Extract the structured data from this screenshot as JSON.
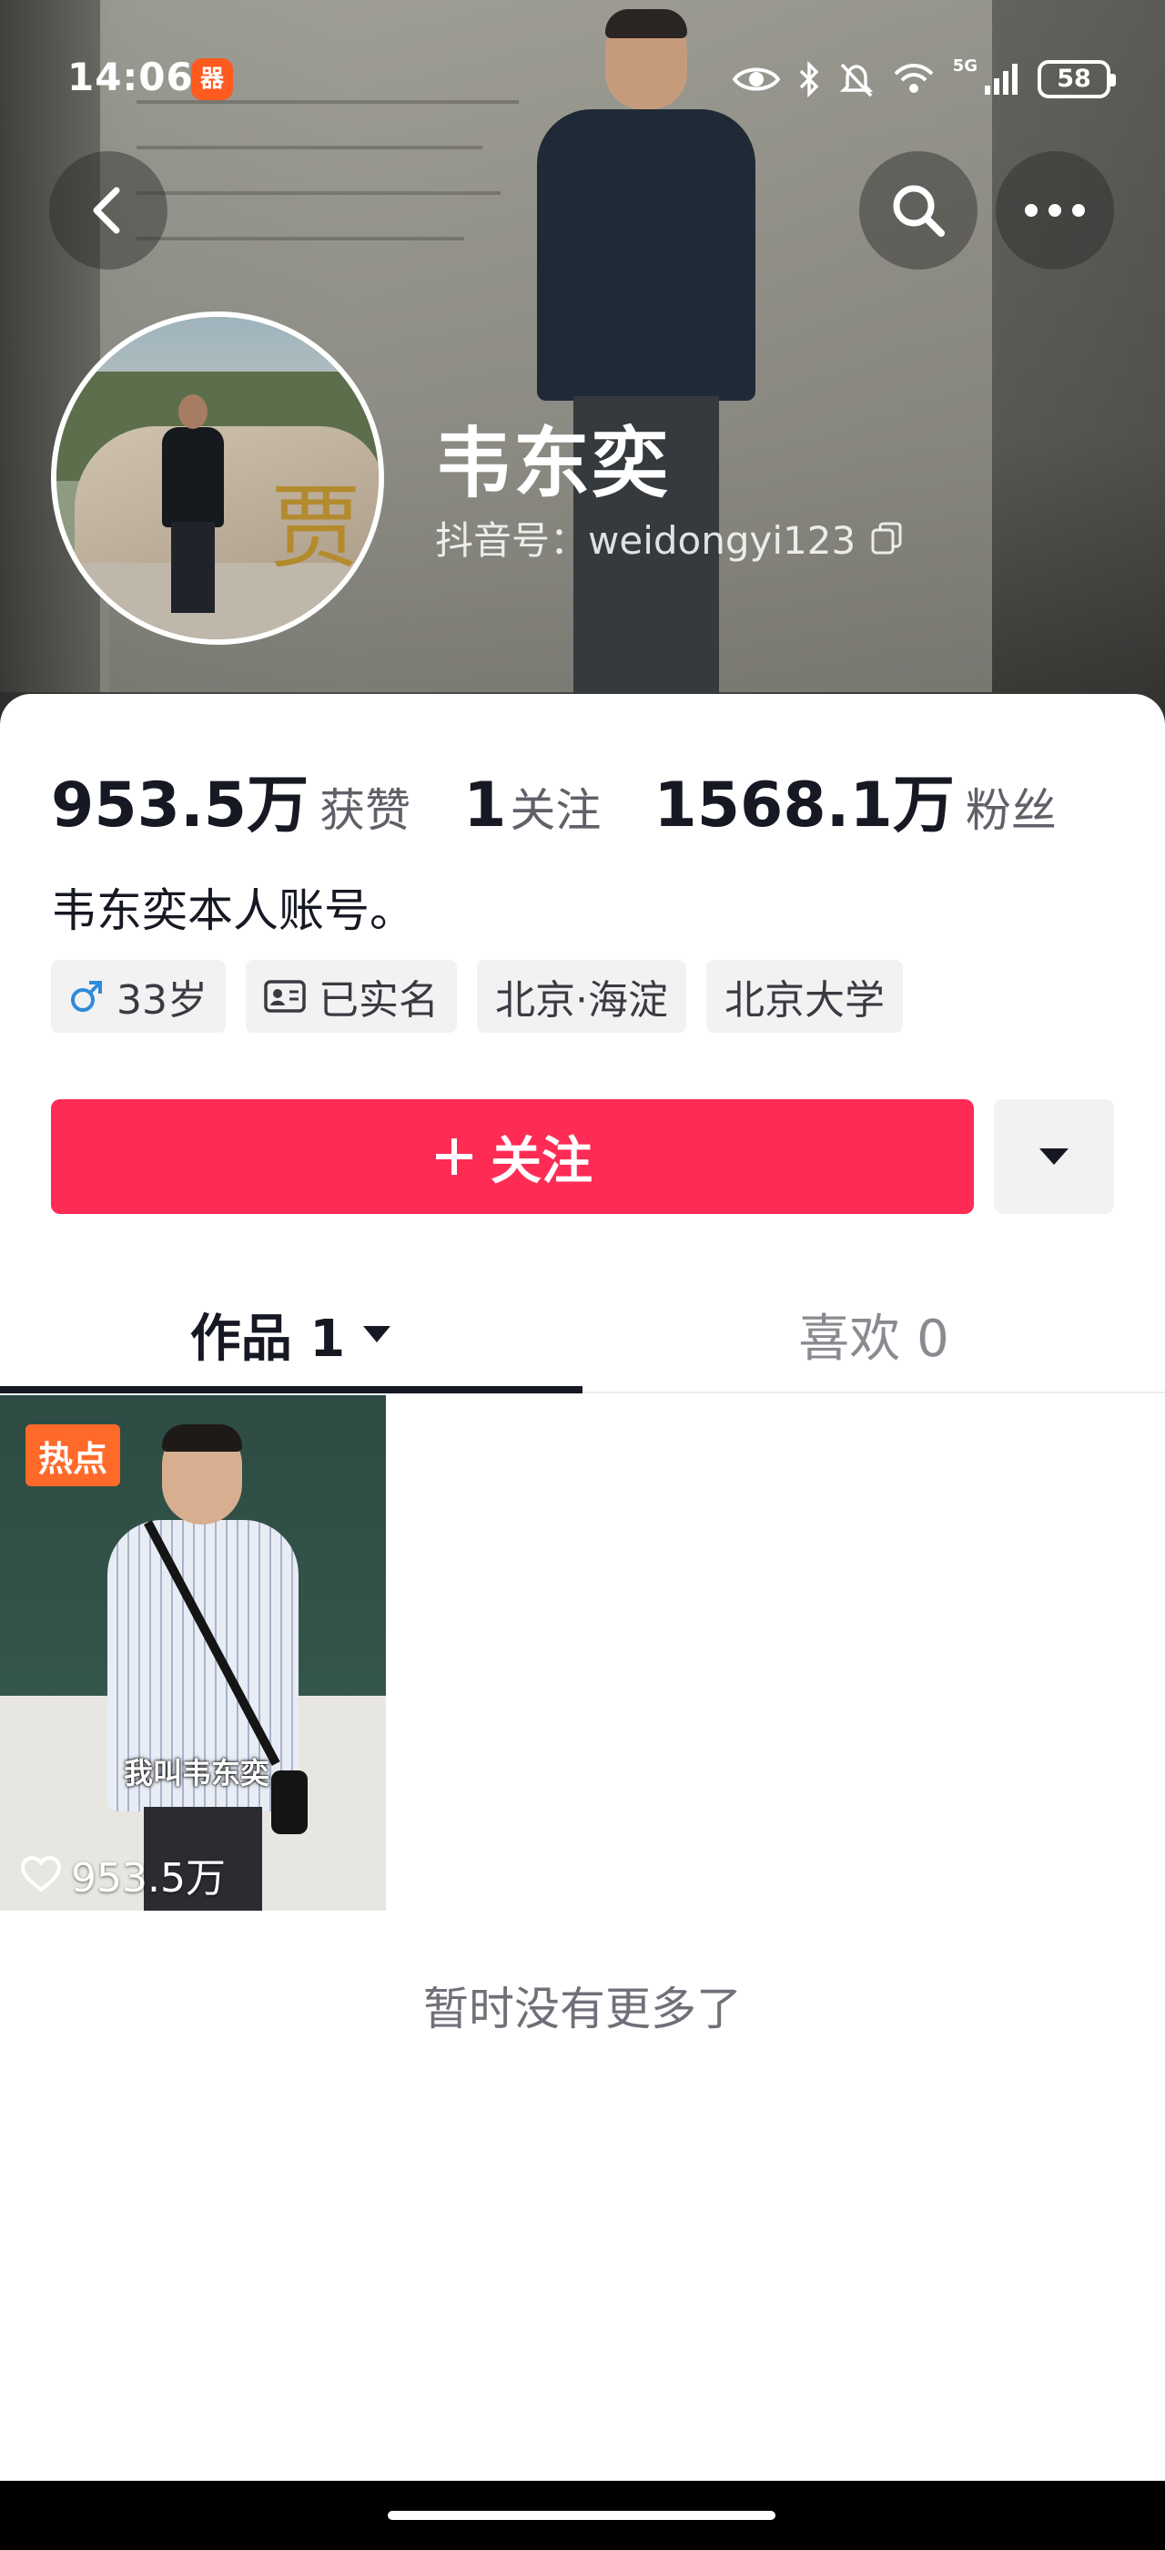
{
  "status_bar": {
    "time": "14:06",
    "battery": "58",
    "network": "5G"
  },
  "header": {
    "nickname": "韦东奕",
    "douyin_id": "抖音号：weidongyi123",
    "icons": [
      "back-icon",
      "search-icon",
      "more-icon"
    ]
  },
  "stats": [
    {
      "num": "953.5万",
      "label": "获赞"
    },
    {
      "num": "1",
      "label": "关注"
    },
    {
      "num": "1568.1万",
      "label": "粉丝"
    }
  ],
  "bio": "韦东奕本人账号。",
  "tags": {
    "age": "33岁",
    "verified": "已实名",
    "location": "北京·海淀",
    "school": "北京大学"
  },
  "actions": {
    "follow": "关注"
  },
  "tabs": {
    "works": "作品 1",
    "likes": "喜欢 0"
  },
  "video": {
    "badge": "热点",
    "caption": "我叫韦东奕",
    "likes": "953.5万"
  },
  "footer": {
    "no_more": "暂时没有更多了"
  },
  "colors": {
    "accent": "#fe2c55",
    "hot_badge": "#ff6a2b"
  }
}
